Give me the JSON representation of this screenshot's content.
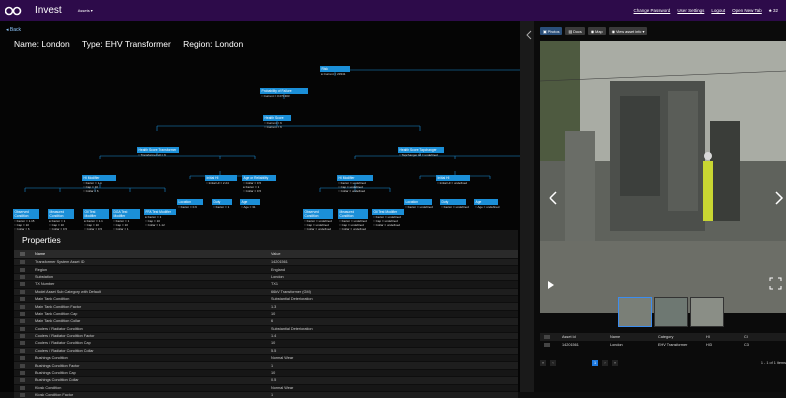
{
  "topbar": {
    "app_name": "Invest",
    "menu_label": "Assets ▾",
    "links": [
      "Change Password",
      "User Settings",
      "Logout",
      "Open New Tab"
    ],
    "bell": "♣ 32"
  },
  "header": {
    "back_label": "Back",
    "name_label": "Name: London",
    "type_label": "Type: EHV Transformer",
    "region_label": "Region: London"
  },
  "tree": {
    "risk": {
      "title": "Risk",
      "lines": [
        "● Current = 23341"
      ]
    },
    "pof": {
      "title": "Probability of Failure",
      "lines": [
        "○ Current = 0.071303"
      ]
    },
    "health": {
      "title": "Health Score",
      "lines": [
        "○ Current = 6",
        "○ Current = 6"
      ]
    },
    "hs_transformer": {
      "title": "Health Score Transformer",
      "lines": [
        "○ Transformer HI = 6"
      ]
    },
    "hs_tapchanger": {
      "title": "Health Score Tapchanger",
      "lines": [
        "○ Tapchanger HI = undefined"
      ]
    },
    "nodes": [
      {
        "title": "HI Modifier",
        "lines": [
          "○ Factor = 1.1",
          "○ Cap = 10",
          "○ Collar = 6"
        ]
      },
      {
        "title": "Initial HI",
        "lines": [
          "○ Initial HI = 2.24"
        ]
      },
      {
        "title": "Age or Reliability",
        "lines": [
          "○ Collar = 0.5",
          "● Factor = 1",
          "○ Collar = 0.5"
        ]
      },
      {
        "title": "HI Modifier",
        "lines": [
          "○ Factor = undefined",
          "○ Cap = undefined",
          "○ Collar = undefined"
        ]
      },
      {
        "title": "Initial HI",
        "lines": [
          "○ Initial HI = undefined"
        ]
      },
      {
        "title": "Observed Condition",
        "lines": [
          "○ Factor = 1.15",
          "○ Cap = 10",
          "○ Collar = 6"
        ]
      },
      {
        "title": "Measured Condition",
        "lines": [
          "● Factor = 1",
          "○ Cap = 10",
          "○ Collar = 0.5"
        ]
      },
      {
        "title": "Oil Test Modifier",
        "lines": [
          "● Factor = 1.1",
          "○ Cap = 10",
          "○ Collar = 0.5"
        ]
      },
      {
        "title": "DGA Test Modifier",
        "lines": [
          "○ Factor = 1",
          "○ Cap = 10",
          "○ Collar = 1"
        ]
      },
      {
        "title": "FFA Test Modifier",
        "lines": [
          "● Factor = 1",
          "○ Cap = 10",
          "○ Collar = 1.12"
        ]
      },
      {
        "title": "Location",
        "lines": [
          "○ Factor = 0.9"
        ]
      },
      {
        "title": "Duty",
        "lines": [
          "○ Factor = 1"
        ]
      },
      {
        "title": "Age",
        "lines": [
          "○ Age = 31"
        ]
      },
      {
        "title": "Observed Condition",
        "lines": [
          "○ Factor = undefined",
          "○ Cap = undefined",
          "○ Collar = undefined"
        ]
      },
      {
        "title": "Measured Condition",
        "lines": [
          "○ Factor = undefined",
          "○ Cap = undefined",
          "○ Collar = undefined"
        ]
      },
      {
        "title": "Oil Test Modifier",
        "lines": [
          "○ Factor = undefined",
          "○ Cap = undefined",
          "○ Collar = undefined"
        ]
      },
      {
        "title": "Location",
        "lines": [
          "○ Factor = undefined"
        ]
      },
      {
        "title": "Duty",
        "lines": [
          "○ Factor = undefined"
        ]
      },
      {
        "title": "Age",
        "lines": [
          "○ Age = undefined"
        ]
      }
    ]
  },
  "properties": {
    "heading": "Properties",
    "col_name": "Name",
    "col_value": "Value",
    "rows": [
      [
        "Transformer System Asset ID",
        "14201561"
      ],
      [
        "Region",
        "England"
      ],
      [
        "Substation",
        "London"
      ],
      [
        "TX Number",
        "TX1"
      ],
      [
        "Model Asset Sub Category with Default",
        "66kV Transformer (GM)"
      ],
      [
        "Main Tank Condition",
        "Substantial Deterioration"
      ],
      [
        "Main Tank Condition Factor",
        "1.3"
      ],
      [
        "Main Tank Condition Cap",
        "10"
      ],
      [
        "Main Tank Condition Collar",
        "6"
      ],
      [
        "Coolers / Radiator Condition",
        "Substantial Deterioration"
      ],
      [
        "Coolers / Radiator Condition Factor",
        "1.4"
      ],
      [
        "Coolers / Radiator Condition Cap",
        "10"
      ],
      [
        "Coolers / Radiator Condition Collar",
        "5.5"
      ],
      [
        "Bushings Condition",
        "Normal Wear"
      ],
      [
        "Bushings Condition Factor",
        "1"
      ],
      [
        "Bushings Condition Cap",
        "10"
      ],
      [
        "Bushings Condition Collar",
        "0.5"
      ],
      [
        "Kiosk Condition",
        "Normal Wear"
      ],
      [
        "Kiosk Condition Factor",
        "1"
      ]
    ]
  },
  "media": {
    "tabs": [
      "Photos",
      "Docs",
      "Map",
      "View asset info ▾"
    ],
    "table_headers": [
      "Asset Id",
      "Name",
      "Category",
      "HI",
      "CI"
    ],
    "table_row": [
      "14201561",
      "London",
      "EHV Transformer",
      "HI3",
      "C3"
    ],
    "pager_current": "1",
    "pager_info": "1 - 1 of 1 items"
  },
  "colors": {
    "topbar": "#2d0b4a",
    "node": "#1b8fd8",
    "page_on": "#1e7ae0"
  }
}
